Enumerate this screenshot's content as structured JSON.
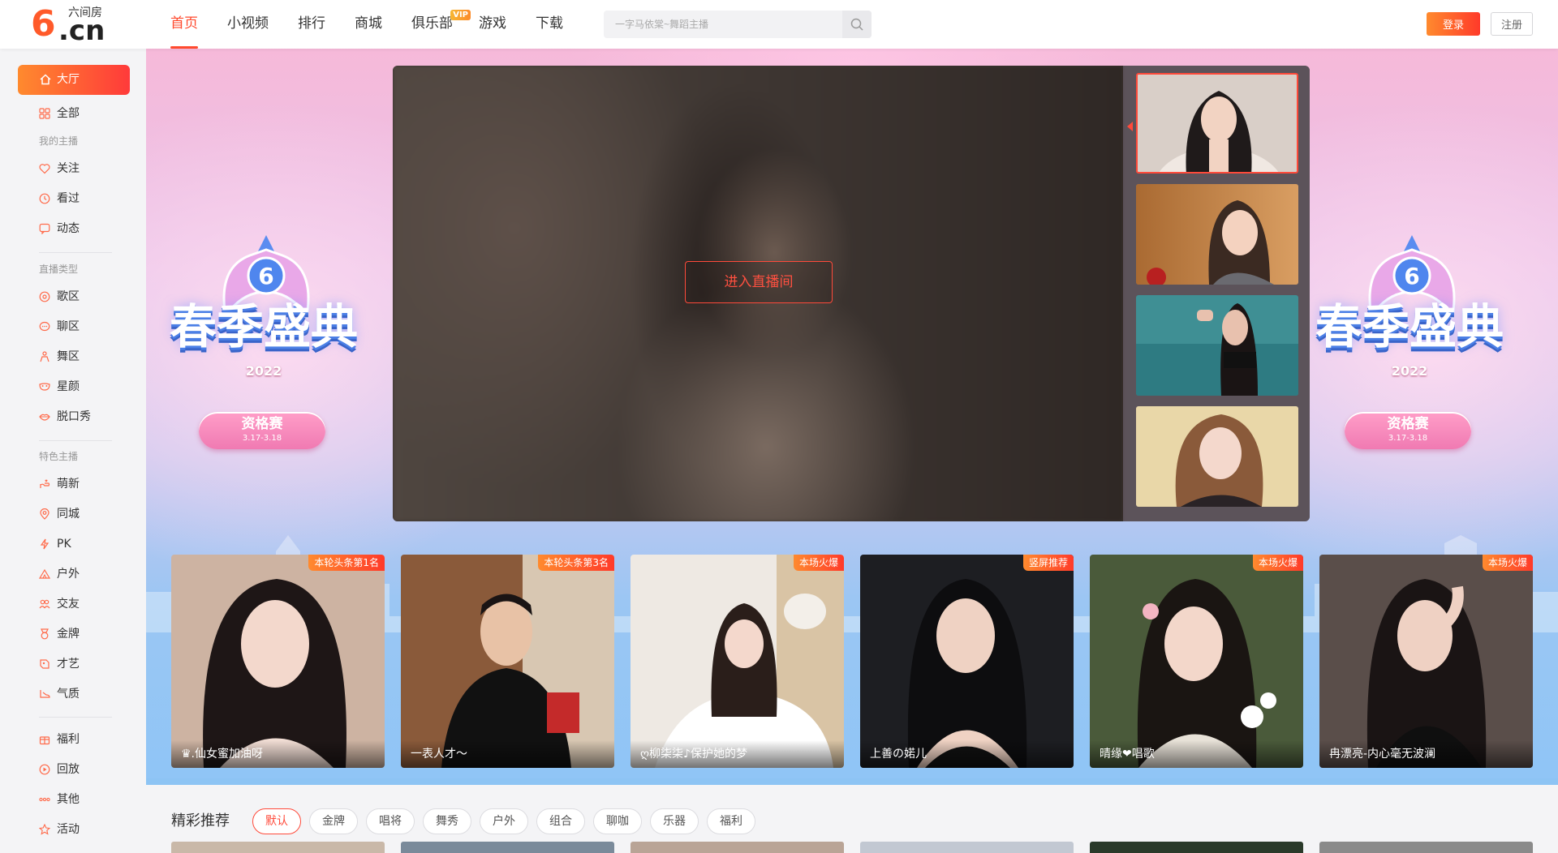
{
  "brand": {
    "mark": "6",
    "cn": ".cn",
    "name": "六间房"
  },
  "nav": [
    {
      "label": "首页",
      "active": true
    },
    {
      "label": "小视频"
    },
    {
      "label": "排行"
    },
    {
      "label": "商城"
    },
    {
      "label": "俱乐部",
      "badge": "VIP"
    },
    {
      "label": "游戏"
    },
    {
      "label": "下载"
    }
  ],
  "search": {
    "placeholder": "一字马依棠~舞蹈主播",
    "icon": "search-icon"
  },
  "auth": {
    "login": "登录",
    "register": "注册"
  },
  "sidebar": {
    "home": "大厅",
    "all": "全部",
    "groups": [
      {
        "heading": "我的主播",
        "items": [
          "关注",
          "看过",
          "动态"
        ]
      },
      {
        "heading": "直播类型",
        "items": [
          "歌区",
          "聊区",
          "舞区",
          "星颜",
          "脱口秀"
        ]
      },
      {
        "heading": "特色主播",
        "items": [
          "萌新",
          "同城",
          "PK",
          "户外",
          "交友",
          "金牌",
          "才艺",
          "气质"
        ]
      },
      {
        "heading": "",
        "items": [
          "福利",
          "回放",
          "其他",
          "活动"
        ]
      }
    ]
  },
  "banner": {
    "title": "春季盛典",
    "year": "2022",
    "pill_main": "资格赛",
    "pill_sub": "3.17-3.18"
  },
  "player": {
    "enter": "进入直播间"
  },
  "featured": [
    {
      "tag": "本轮头条第1名",
      "name": "♛.仙女蜜加油呀"
    },
    {
      "tag": "本轮头条第3名",
      "name": "一表人才～"
    },
    {
      "tag": "本场火爆",
      "name": "ღ柳柒柒♪保护她的梦"
    },
    {
      "tag": "竖屏推荐",
      "name": "上善の婼儿"
    },
    {
      "tag": "本场火爆",
      "name": "晴缘❤唱歌"
    },
    {
      "tag": "本场火爆",
      "name": "冉漂亮-内心毫无波澜"
    }
  ],
  "recommend": {
    "title": "精彩推荐",
    "tabs": [
      "默认",
      "金牌",
      "唱将",
      "舞秀",
      "户外",
      "组合",
      "聊咖",
      "乐器",
      "福利"
    ]
  },
  "colors": {
    "accent": "#ff4a2e",
    "gradient_start": "#ff8a2e",
    "gradient_end": "#ff3a2a"
  }
}
